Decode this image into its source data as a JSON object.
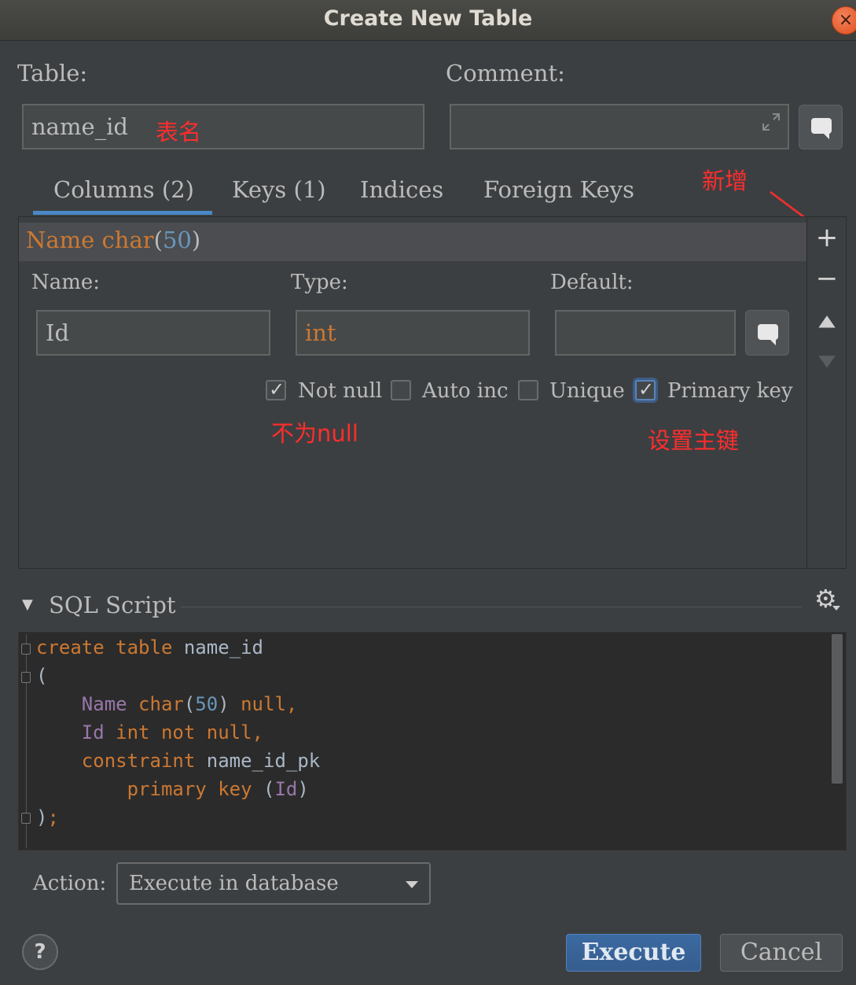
{
  "window": {
    "title": "Create New Table",
    "close_glyph": "×"
  },
  "table_form": {
    "table_label": "Table:",
    "table_value": "name_id",
    "comment_label": "Comment:",
    "comment_value": ""
  },
  "annotations": {
    "table_name": "表名",
    "add": "新增",
    "not_null": "不为null",
    "primary_key": "设置主键"
  },
  "tabs": [
    {
      "label": "Columns (2)",
      "active": true
    },
    {
      "label": "Keys (1)",
      "active": false
    },
    {
      "label": "Indices",
      "active": false
    },
    {
      "label": "Foreign Keys",
      "active": false
    }
  ],
  "column_list": {
    "row": {
      "name": "Name",
      "type_word": "char",
      "paren_open": "(",
      "length": "50",
      "paren_close": ")"
    }
  },
  "column_editor": {
    "name_label": "Name:",
    "name_value": "Id",
    "type_label": "Type:",
    "type_value": "int",
    "default_label": "Default:",
    "default_value": "",
    "checkboxes": [
      {
        "label": "Not null",
        "checked": true
      },
      {
        "label": "Auto inc",
        "checked": false
      },
      {
        "label": "Unique",
        "checked": false
      },
      {
        "label": "Primary key",
        "checked": true
      }
    ]
  },
  "side_toolbar": {
    "add_glyph": "+",
    "remove_glyph": "−",
    "up_glyph": "▲",
    "down_glyph": "▼"
  },
  "sql_script": {
    "title": "SQL Script",
    "collapse_glyph": "▼",
    "settings_glyph": "⚙",
    "lines": {
      "l1_kw": "create table",
      "l1_id": " name_id",
      "l2": "(",
      "l3_col": "Name",
      "l3_type": " char",
      "l3_p1": "(",
      "l3_num": "50",
      "l3_p2": ")",
      "l3_rest": " null,",
      "l4_col": "Id",
      "l4_rest": " int not null,",
      "l5_kw": "constraint",
      "l5_id": " name_id_pk",
      "l6_kw": "primary key",
      "l6_p1": " (",
      "l6_col": "Id",
      "l6_p2": ")",
      "l7_p": ")",
      "l7_semi": ";"
    }
  },
  "action": {
    "label": "Action:",
    "selected": "Execute in database"
  },
  "buttons": {
    "help": "?",
    "execute": "Execute",
    "cancel": "Cancel"
  },
  "colors": {
    "background": "#3c3f41",
    "accent": "#4a88c7",
    "annotation": "#ff2d2d",
    "keyword": "#cc7832",
    "number": "#6897bb",
    "column": "#9876aa"
  }
}
